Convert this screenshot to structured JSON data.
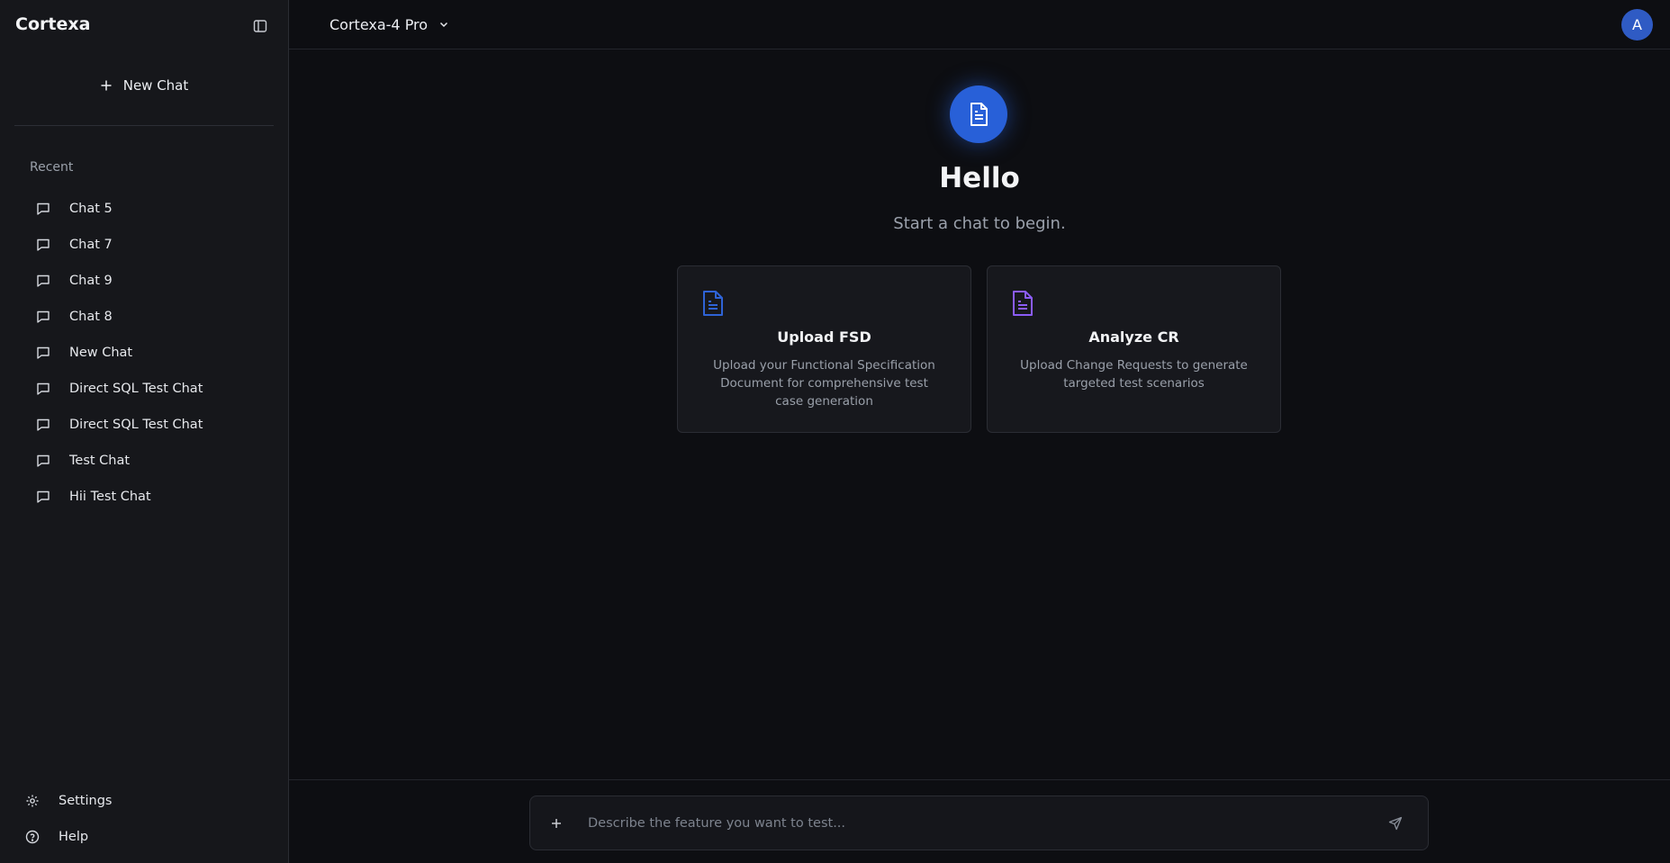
{
  "app": {
    "brand": "Cortexa"
  },
  "sidebar": {
    "new_chat_label": "New Chat",
    "recent_label": "Recent",
    "chats": [
      {
        "label": "Chat 5"
      },
      {
        "label": "Chat 7"
      },
      {
        "label": "Chat 9"
      },
      {
        "label": "Chat 8"
      },
      {
        "label": "New Chat"
      },
      {
        "label": "Direct SQL Test Chat"
      },
      {
        "label": "Direct SQL Test Chat"
      },
      {
        "label": "Test Chat"
      },
      {
        "label": "Hii Test Chat"
      }
    ],
    "settings_label": "Settings",
    "help_label": "Help"
  },
  "header": {
    "model": "Cortexa-4 Pro",
    "avatar_initial": "A"
  },
  "main": {
    "greeting": "Hello",
    "subtitle": "Start a chat to begin.",
    "cards": [
      {
        "title": "Upload FSD",
        "description": "Upload your Functional Specification Document for comprehensive test case generation",
        "icon": "document-icon",
        "icon_color": "#2f63d6"
      },
      {
        "title": "Analyze CR",
        "description": "Upload Change Requests to generate targeted test scenarios",
        "icon": "document-icon",
        "icon_color": "#8b5cf6"
      }
    ]
  },
  "composer": {
    "placeholder": "Describe the feature you want to test...",
    "value": ""
  },
  "colors": {
    "accent": "#2860d8",
    "background": "#0d0e12",
    "sidebar": "#16171b"
  }
}
